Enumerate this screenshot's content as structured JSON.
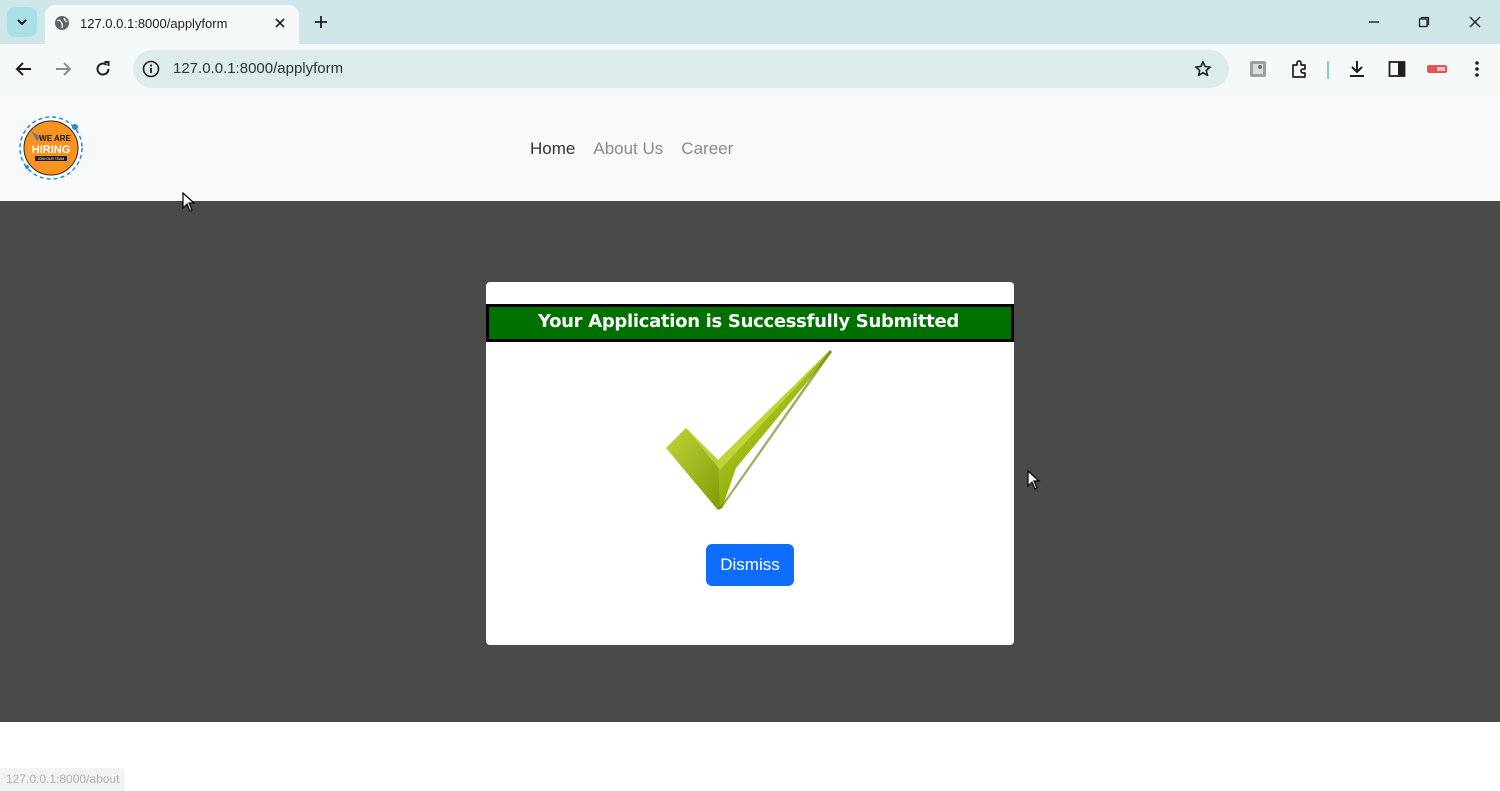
{
  "browser": {
    "tab_title": "127.0.0.1:8000/applyform",
    "url": "127.0.0.1:8000/applyform",
    "status_url": "127.0.0.1:8000/about"
  },
  "site": {
    "logo_alt": "We are hiring logo",
    "logo_text": {
      "line1": "WE ARE",
      "line2": "HIRING",
      "line3": "JOIN OUR TEAM"
    },
    "nav": [
      {
        "label": "Home",
        "active": true
      },
      {
        "label": "About Us",
        "active": false
      },
      {
        "label": "Career",
        "active": false
      }
    ]
  },
  "modal": {
    "message": "Your Application is Successfully Submitted",
    "dismiss_label": "Dismiss"
  },
  "colors": {
    "banner": "#007000",
    "button": "#0d6efd",
    "overlay": "#4a4a4a"
  }
}
